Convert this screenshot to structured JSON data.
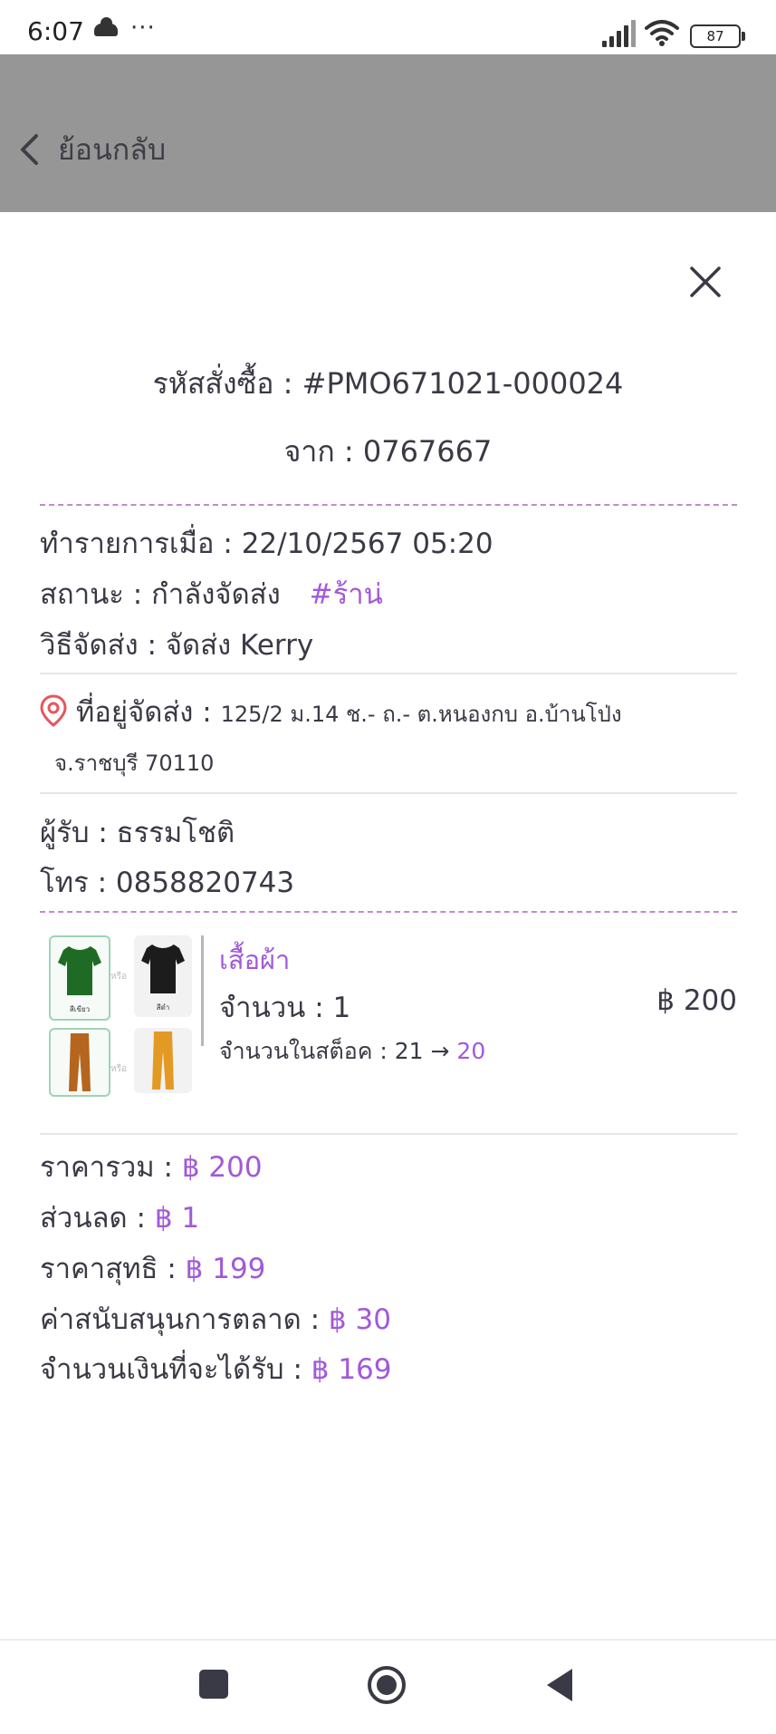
{
  "status_bar": {
    "time": "6:07",
    "dots": "···",
    "battery": "87"
  },
  "header": {
    "back_label": "ย้อนกลับ"
  },
  "order": {
    "code_line": "รหัสสั่งซื้อ : #PMO671021-000024",
    "from_line": "จาก : 0767667",
    "datetime_line": "ทำรายการเมื่อ : 22/10/2567 05:20",
    "status_line": "สถานะ : กำลังจัดส่ง",
    "status_tag": "#ร้าน่",
    "shipping_method_line": "วิธีจัดส่ง : จัดส่ง  Kerry",
    "address_label": "ที่อยู่จัดส่ง :",
    "address_part1": "125/2  ม.14  ช.-  ถ.-  ต.หนองกบ  อ.บ้านโป่ง",
    "address_part2": "จ.ราชบุรี  70110",
    "recipient_line": "ผู้รับ : ธรรมโชติ",
    "phone_line": "โทร : 0858820743"
  },
  "item": {
    "name": "เสื้อผ้า",
    "qty_line": "จำนวน : 1",
    "price": "฿ 200",
    "stock_label": "จำนวนในสต็อค : 21 →",
    "stock_new": "20",
    "thumb_captions": [
      "สีเขียว",
      "สีดำ"
    ],
    "or_text": "หรือ"
  },
  "summary": {
    "total_label": "ราคารวม :",
    "total_value": "฿ 200",
    "discount_label": "ส่วนลด :",
    "discount_value": "฿ 1",
    "net_label": "ราคาสุทธิ :",
    "net_value": "฿ 199",
    "marketing_label": "ค่าสนับสนุนการตลาด :",
    "marketing_value": "฿ 30",
    "receive_label": "จำนวนเงินที่จะได้รับ :",
    "receive_value": "฿ 169"
  },
  "colors": {
    "accent": "#a259d9",
    "header_bg": "#969696",
    "divider_dash": "#c28acb"
  },
  "icons": [
    "cloud-icon",
    "signal-icon",
    "wifi-icon",
    "battery-icon",
    "back-chevron-icon",
    "close-icon",
    "location-pin-icon",
    "nav-square-icon",
    "nav-home-icon",
    "nav-back-icon"
  ]
}
